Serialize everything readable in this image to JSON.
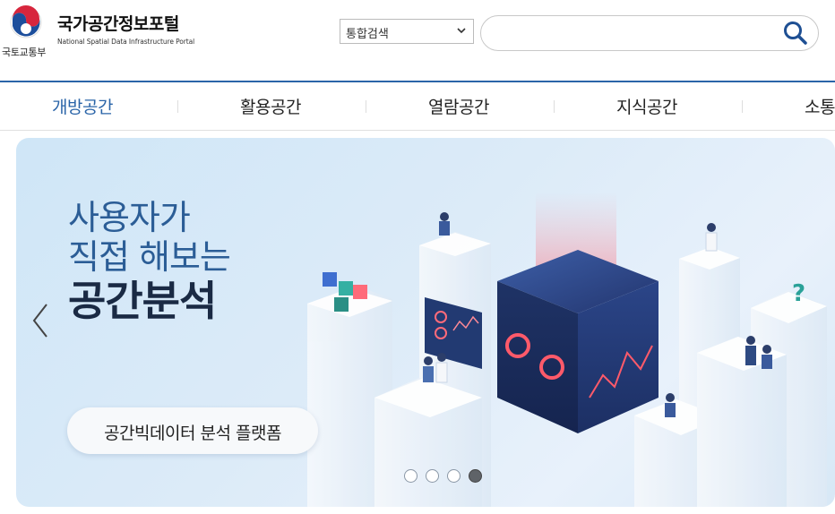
{
  "header": {
    "ministry": "국토교통부",
    "portal_title": "국가공간정보포털",
    "portal_subtitle": "National Spatial Data Infrastructure Portal",
    "search_select_value": "통합검색",
    "search_placeholder": "",
    "search_icon": "search-icon"
  },
  "nav": {
    "items": [
      {
        "label": "개방공간",
        "active": true
      },
      {
        "label": "활용공간",
        "active": false
      },
      {
        "label": "열람공간",
        "active": false
      },
      {
        "label": "지식공간",
        "active": false
      },
      {
        "label": "소통",
        "active": false
      }
    ]
  },
  "banner": {
    "line1": "사용자가",
    "line2": "직접 해보는",
    "line3": "공간분석",
    "button_label": "공간빅데이터 분석 플랫폼",
    "prev_icon": "chevron-left-icon",
    "slides": 4,
    "active_slide": 4
  },
  "colors": {
    "accent": "#2a64a8",
    "active_nav": "#2a64a8",
    "title_blue": "#2b5d96",
    "title_dark": "#1a2a44"
  }
}
